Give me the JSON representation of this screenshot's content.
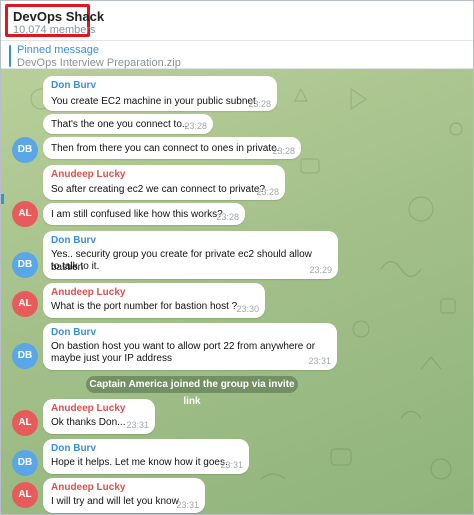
{
  "header": {
    "title": "DevOps Shack",
    "members": "10,074 members"
  },
  "pinned": {
    "label": "Pinned message",
    "text": "DevOps Interview Preparation.zip"
  },
  "colors": {
    "don": "#3a8fd9",
    "anudeep": "#d9534f",
    "avatar_db": "#5aa7e8",
    "avatar_al": "#e85b5b"
  },
  "messages": [
    {
      "sender": "Don Burv",
      "text": "You create EC2 machine in your public subnet",
      "time": "23:28"
    },
    {
      "text": "That's the one you connect to..",
      "time": "23:28"
    },
    {
      "text": "Then from there you can connect to ones in private.",
      "time": "23:28",
      "avatar": "DB"
    },
    {
      "sender": "Anudeep Lucky",
      "text": "So after creating ec2 we can connect to private?",
      "time": "23:28"
    },
    {
      "text": "I am still confused like how this works?",
      "time": "23:28",
      "avatar": "AL"
    },
    {
      "sender": "Don Burv",
      "line1": "Yes.. security group you create for private ec2 should allow bastion",
      "line2": "to talk to it.",
      "time": "23:29",
      "avatar": "DB"
    },
    {
      "sender": "Anudeep Lucky",
      "text": "What is the port number for bastion host ?",
      "time": "23:30",
      "avatar": "AL"
    },
    {
      "sender": "Don Burv",
      "line1": "On bastion host you want to allow port 22 from anywhere or",
      "line2": "maybe just your IP address",
      "time": "23:31",
      "avatar": "DB"
    },
    {
      "sender": "Anudeep Lucky",
      "text": "Ok thanks Don...",
      "time": "23:31",
      "avatar": "AL"
    },
    {
      "sender": "Don Burv",
      "text": "Hope it helps. Let me know how it goes.",
      "time": "23:31",
      "avatar": "DB"
    },
    {
      "sender": "Anudeep Lucky",
      "text": "I will try and will let you know",
      "time": "23:31",
      "avatar": "AL"
    }
  ],
  "service_message": "Captain America joined the group via invite link"
}
